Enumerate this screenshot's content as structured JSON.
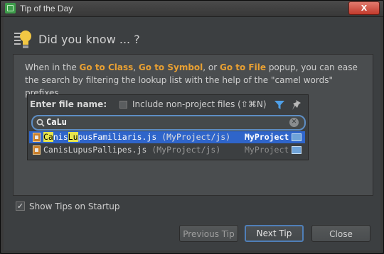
{
  "window": {
    "title": "Tip of the Day",
    "close_label": "X"
  },
  "header": {
    "title": "Did you know ... ?"
  },
  "tip": {
    "p1": "When in the ",
    "k1": "Go to Class",
    "p2": ", ",
    "k2": "Go to Symbol",
    "p3": ", or ",
    "k3": "Go to File",
    "p4": " popup, you can ease the search by filtering the lookup list with the help of the \"camel words\" prefixes."
  },
  "popup": {
    "label": "Enter file name:",
    "include_label": "Include non-project files (⇧⌘N)",
    "search_value": "CaLu",
    "results": [
      {
        "name_ca": "Ca",
        "name_mid": "nis",
        "name_lu": "Lu",
        "name_rest": "pusFamiliaris.js",
        "path": " (MyProject/js)",
        "project": "MyProject"
      },
      {
        "name": "CanisLupusPallipes.js",
        "path": " (MyProject/js)",
        "project": "MyProject"
      }
    ]
  },
  "startup": {
    "label": "Show Tips on Startup",
    "checked": true
  },
  "buttons": {
    "previous": "Previous Tip",
    "next": "Next Tip",
    "close": "Close"
  }
}
